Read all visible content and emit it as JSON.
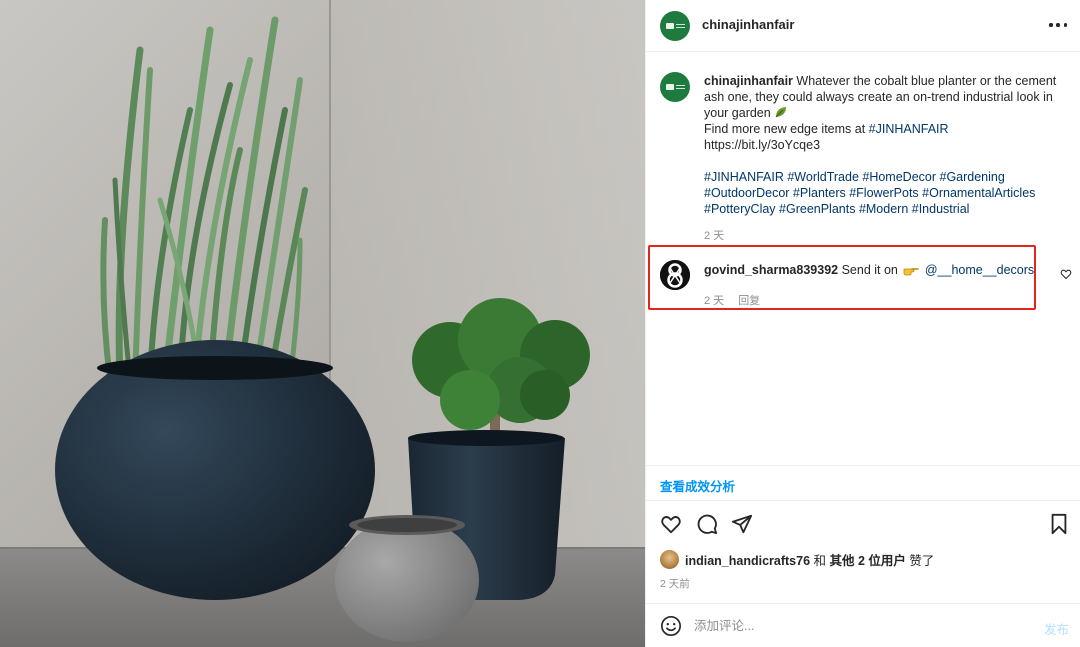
{
  "post": {
    "account": "chinajinhanfair",
    "caption": {
      "username": "chinajinhanfair",
      "text_line1": "Whatever the cobalt blue planter or the cement ash one, they could always create an on-trend industrial look in your garden",
      "find_more_prefix": "Find more new edge items at ",
      "find_more_tag": "#JINHANFAIR",
      "url": "https://bit.ly/3oYcqe3",
      "hashtags_line1": "#JINHANFAIR #WorldTrade #HomeDecor #Gardening",
      "hashtags_line2": "#OutdoorDecor #Planters #FlowerPots #OrnamentalArticles",
      "hashtags_line3": "#PotteryClay #GreenPlants #Modern #Industrial",
      "time": "2 天"
    },
    "comment": {
      "username": "govind_sharma839392",
      "text": "Send it on",
      "mention": "@__home__decors",
      "time": "2 天",
      "reply_label": "回复"
    },
    "insights_label": "查看成效分析",
    "likes": {
      "username": "indian_handicrafts76",
      "suffix": " 和 ",
      "others": "其他 2 位用户",
      "liked": " 赞了"
    },
    "post_time": "2 天前",
    "input": {
      "placeholder": "添加评论...",
      "post_label": "发布"
    }
  },
  "icons": {
    "more": "more-horizontal-icon",
    "heart": "heart-icon",
    "comment": "comment-icon",
    "share": "share-paper-plane-icon",
    "save": "bookmark-icon",
    "emoji": "smiley-icon"
  },
  "colors": {
    "link_blue": "#00376b",
    "action_blue": "#0095f6",
    "highlight_red": "#e2261d",
    "brand_green": "#1e7a3e"
  }
}
